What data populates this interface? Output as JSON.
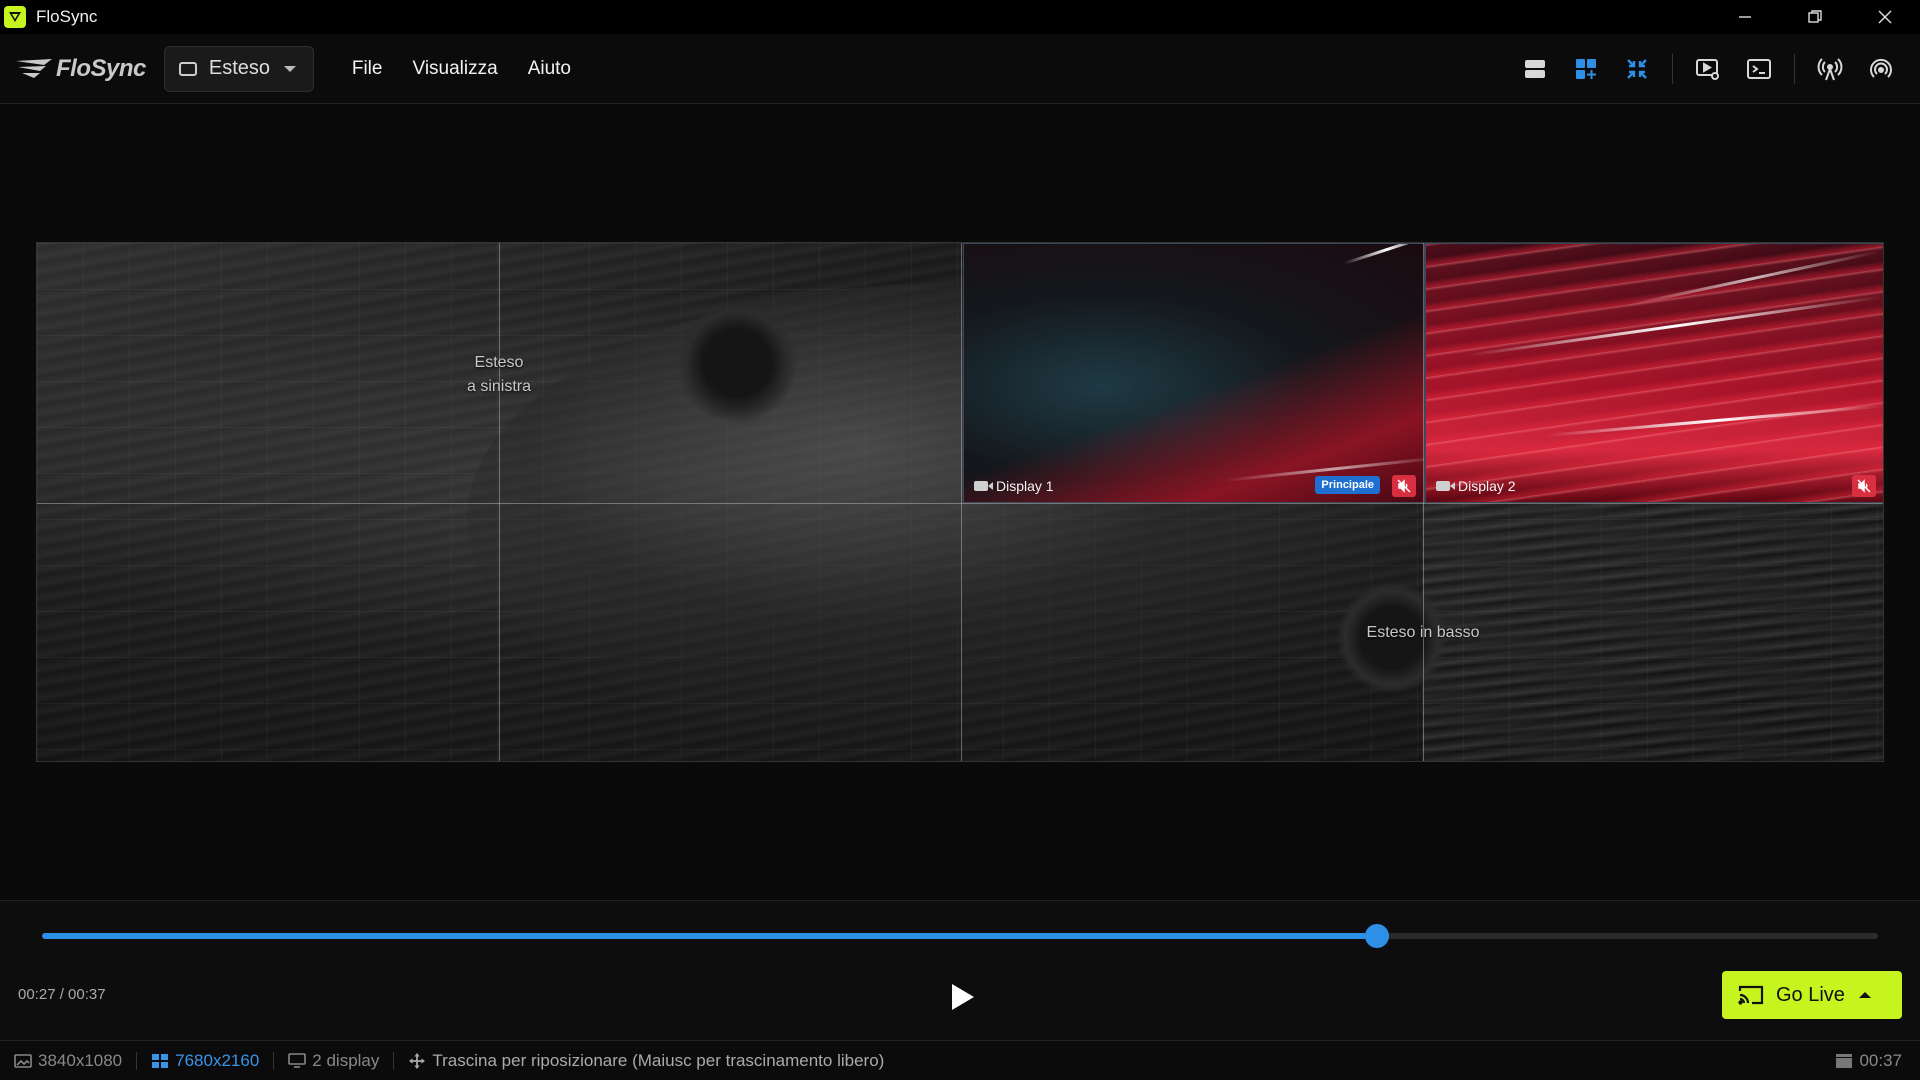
{
  "window": {
    "title": "FloSync"
  },
  "menubar": {
    "brand": "FloSync",
    "mode": "Esteso",
    "menus": [
      "File",
      "Visualizza",
      "Aiuto"
    ]
  },
  "toolbar": {
    "icons": [
      "rows-icon",
      "grid-add-icon",
      "collapse-icon",
      "preview-settings-icon",
      "terminal-icon",
      "broadcast-icon",
      "signal-icon"
    ],
    "active_color": "#2d8fe6"
  },
  "canvas": {
    "region_left": {
      "line1": "Esteso",
      "line2": "a sinistra"
    },
    "region_bottom": "Esteso in basso",
    "display1": {
      "label": "Display 1",
      "badge": "Principale"
    },
    "display2": {
      "label": "Display 2"
    }
  },
  "playback": {
    "time": "00:27 / 00:37",
    "progress": 0.727
  },
  "golive": {
    "label": "Go Live",
    "color": "#c6f41e"
  },
  "status": {
    "resolution_display": "3840x1080",
    "resolution_canvas": "7680x2160",
    "display_count": "2 display",
    "hint": "Trascina per riposizionare (Maiusc per trascinamento libero)",
    "duration": "00:37"
  }
}
